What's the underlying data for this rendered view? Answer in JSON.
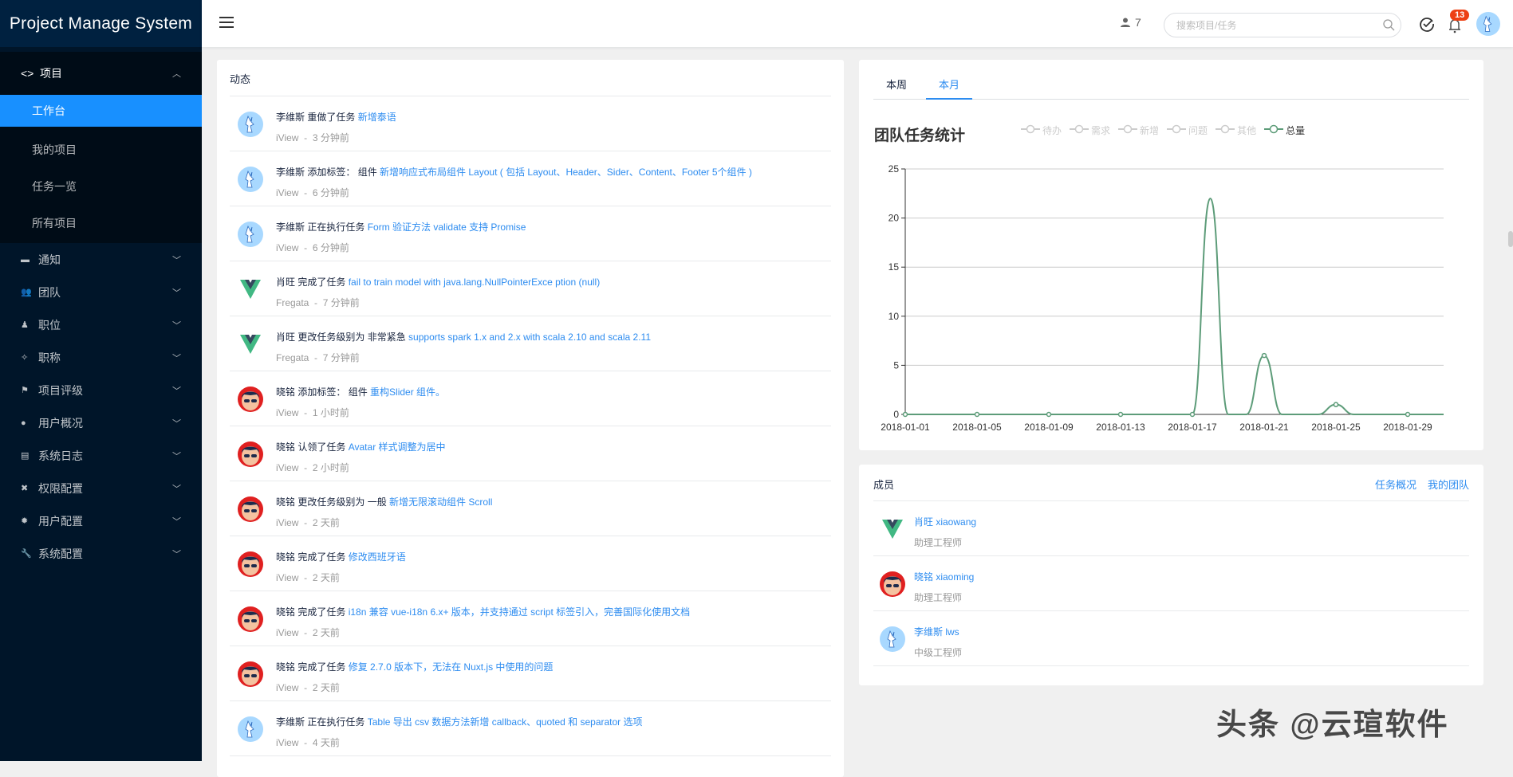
{
  "app": {
    "title": "Project Manage System"
  },
  "sidebar": {
    "group": {
      "label": "项目",
      "icon": "code-icon",
      "expanded": true,
      "items": [
        {
          "label": "工作台",
          "active": true
        },
        {
          "label": "我的项目"
        },
        {
          "label": "任务一览"
        },
        {
          "label": "所有项目"
        }
      ]
    },
    "items": [
      {
        "label": "通知",
        "icon": "mail-icon"
      },
      {
        "label": "团队",
        "icon": "team-icon"
      },
      {
        "label": "职位",
        "icon": "position-icon"
      },
      {
        "label": "职称",
        "icon": "magic-wand-icon"
      },
      {
        "label": "项目评级",
        "icon": "flag-icon"
      },
      {
        "label": "用户概况",
        "icon": "user-icon"
      },
      {
        "label": "系统日志",
        "icon": "log-icon"
      },
      {
        "label": "权限配置",
        "icon": "tools-icon"
      },
      {
        "label": "用户配置",
        "icon": "gear-icon"
      },
      {
        "label": "系统配置",
        "icon": "wrench-icon"
      }
    ]
  },
  "header": {
    "online_count": "7",
    "search_placeholder": "搜索项目/任务",
    "notification_count": "13"
  },
  "activity": {
    "title": "动态",
    "items": [
      {
        "avatar": "deer",
        "user": "李维斯",
        "action": "重做了任务",
        "target": "新增泰语",
        "source": "iView",
        "time": "3 分钟前"
      },
      {
        "avatar": "deer",
        "user": "李维斯",
        "action": "添加标签： 组件",
        "target": "新增响应式布局组件 Layout ( 包括 Layout、Header、Sider、Content、Footer 5个组件 )",
        "source": "iView",
        "time": "6 分钟前"
      },
      {
        "avatar": "deer",
        "user": "李维斯",
        "action": "正在执行任务",
        "target": "Form 验证方法 validate 支持 Promise",
        "source": "iView",
        "time": "6 分钟前"
      },
      {
        "avatar": "vue",
        "user": "肖旺",
        "action": "完成了任务",
        "target": "fail to train model with java.lang.NullPointerExce ption (null)",
        "source": "Fregata",
        "time": "7 分钟前"
      },
      {
        "avatar": "vue",
        "user": "肖旺",
        "action": "更改任务级别为 非常紧急",
        "target": "supports spark 1.x and 2.x with scala 2.10 and scala 2.11",
        "source": "Fregata",
        "time": "7 分钟前"
      },
      {
        "avatar": "face",
        "user": "晓铭",
        "action": "添加标签： 组件",
        "target": "重构Slider 组件。",
        "source": "iView",
        "time": "1 小时前"
      },
      {
        "avatar": "face",
        "user": "晓铭",
        "action": "认领了任务",
        "target": "Avatar 样式调整为居中",
        "source": "iView",
        "time": "2 小时前"
      },
      {
        "avatar": "face",
        "user": "晓铭",
        "action": "更改任务级别为 一般",
        "target": "新增无限滚动组件 Scroll",
        "source": "iView",
        "time": "2 天前"
      },
      {
        "avatar": "face",
        "user": "晓铭",
        "action": "完成了任务",
        "target": "修改西班牙语",
        "source": "iView",
        "time": "2 天前"
      },
      {
        "avatar": "face",
        "user": "晓铭",
        "action": "完成了任务",
        "target": "i18n 兼容 vue-i18n 6.x+ 版本，并支持通过 script 标签引入，完善国际化使用文档",
        "source": "iView",
        "time": "2 天前"
      },
      {
        "avatar": "face",
        "user": "晓铭",
        "action": "完成了任务",
        "target": "修复 2.7.0 版本下，无法在 Nuxt.js 中使用的问题",
        "source": "iView",
        "time": "2 天前"
      },
      {
        "avatar": "deer",
        "user": "李维斯",
        "action": "正在执行任务",
        "target": "Table 导出 csv 数据方法新增 callback、quoted 和 separator 选项",
        "source": "iView",
        "time": "4 天前"
      }
    ]
  },
  "stats": {
    "tabs": [
      {
        "label": "本周"
      },
      {
        "label": "本月",
        "active": true
      }
    ]
  },
  "chart_data": {
    "type": "line",
    "title": "团队任务统计",
    "legend": [
      {
        "name": "待办",
        "active": false
      },
      {
        "name": "需求",
        "active": false
      },
      {
        "name": "新增",
        "active": false
      },
      {
        "name": "问题",
        "active": false
      },
      {
        "name": "其他",
        "active": false
      },
      {
        "name": "总量",
        "active": true
      }
    ],
    "legend_placement": "top",
    "x": [
      "2018-01-01",
      "2018-01-02",
      "2018-01-03",
      "2018-01-04",
      "2018-01-05",
      "2018-01-06",
      "2018-01-07",
      "2018-01-08",
      "2018-01-09",
      "2018-01-10",
      "2018-01-11",
      "2018-01-12",
      "2018-01-13",
      "2018-01-14",
      "2018-01-15",
      "2018-01-16",
      "2018-01-17",
      "2018-01-18",
      "2018-01-19",
      "2018-01-20",
      "2018-01-21",
      "2018-01-22",
      "2018-01-23",
      "2018-01-24",
      "2018-01-25",
      "2018-01-26",
      "2018-01-27",
      "2018-01-28",
      "2018-01-29",
      "2018-01-30",
      "2018-01-31"
    ],
    "series": [
      {
        "name": "总量",
        "values": [
          0,
          0,
          0,
          0,
          0,
          0,
          0,
          0,
          0,
          0,
          0,
          0,
          0,
          0,
          0,
          0,
          0,
          22,
          0,
          0,
          6,
          0,
          0,
          0,
          1,
          0,
          0,
          0,
          0,
          0,
          0
        ]
      }
    ],
    "x_tick_labels": [
      "2018-01-01",
      "2018-01-05",
      "2018-01-09",
      "2018-01-13",
      "2018-01-17",
      "2018-01-21",
      "2018-01-25",
      "2018-01-29"
    ],
    "y_ticks": [
      0,
      5,
      10,
      15,
      20,
      25
    ],
    "ylim": [
      0,
      25
    ],
    "grid": true,
    "smooth": true,
    "color": "#5d9c79"
  },
  "members": {
    "title": "成员",
    "links": [
      "任务概况",
      "我的团队"
    ],
    "items": [
      {
        "avatar": "vue",
        "name": "肖旺 xiaowang",
        "role": "助理工程师"
      },
      {
        "avatar": "face",
        "name": "晓铭 xiaoming",
        "role": "助理工程师"
      },
      {
        "avatar": "deer",
        "name": "李维斯 lws",
        "role": "中级工程师"
      }
    ]
  },
  "watermark": "头条 @云瑄软件",
  "colors": {
    "sidebar": "#001529",
    "accent": "#1890ff",
    "link": "#2d8cf0",
    "badge": "#ed4014"
  }
}
